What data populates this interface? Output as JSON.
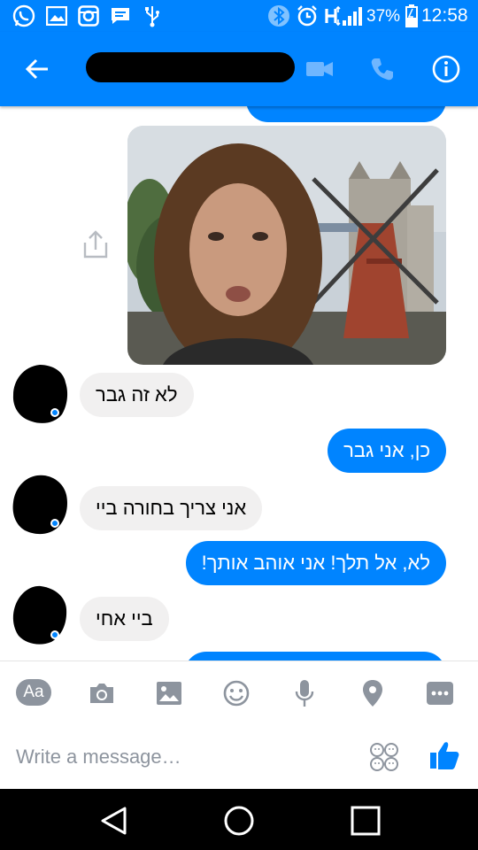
{
  "status_bar": {
    "battery_percent": "37%",
    "time": "12:58",
    "icons": [
      "whatsapp-icon",
      "gallery-icon",
      "instagram-icon",
      "message-icon",
      "usb-icon",
      "bluetooth-icon",
      "alarm-icon",
      "data-h-icon",
      "signal-icon",
      "battery-icon"
    ]
  },
  "header": {
    "icons": [
      "back-arrow-icon",
      "video-call-icon",
      "phone-call-icon",
      "info-icon"
    ]
  },
  "messages": [
    {
      "direction": "out",
      "text": "כן, אני גבר"
    },
    {
      "direction": "in",
      "text": "לא זה גבר"
    },
    {
      "direction": "in",
      "text": "אני צריך בחורה ביי"
    },
    {
      "direction": "out",
      "text": "לא, אל תלך! אני אוהב אותך!"
    },
    {
      "direction": "in",
      "text": "ביי אחי"
    }
  ],
  "composer": {
    "aa_label": "Aa",
    "placeholder": "Write a message…",
    "icons": [
      "camera-icon",
      "gallery-icon",
      "emoji-icon",
      "microphone-icon",
      "location-icon",
      "more-icon",
      "stickers-icon",
      "thumbs-up-icon"
    ]
  },
  "colors": {
    "accent": "#0084ff",
    "incoming_bubble": "#f1f0f0",
    "icon_gray": "#8d949e"
  }
}
